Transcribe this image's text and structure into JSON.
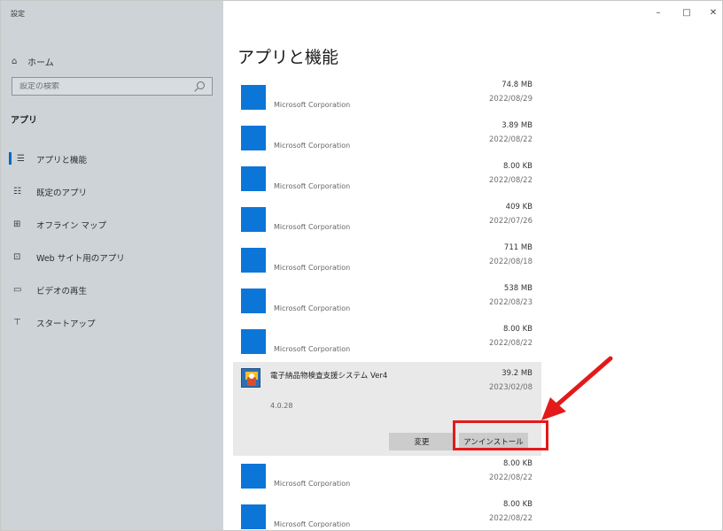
{
  "window": {
    "title": "設定",
    "controls": {
      "minimize": "–",
      "maximize": "□",
      "close": "✕"
    }
  },
  "sidebar": {
    "home": {
      "icon": "home-icon",
      "label": "ホーム"
    },
    "search": {
      "placeholder": "設定の検索",
      "icon": "search-icon"
    },
    "section_title": "アプリ",
    "items": [
      {
        "icon": "apps-features-icon",
        "label": "アプリと機能",
        "active": true
      },
      {
        "icon": "default-apps-icon",
        "label": "既定のアプリ",
        "active": false
      },
      {
        "icon": "offline-maps-icon",
        "label": "オフライン マップ",
        "active": false
      },
      {
        "icon": "web-apps-icon",
        "label": "Web サイト用のアプリ",
        "active": false
      },
      {
        "icon": "video-playback-icon",
        "label": "ビデオの再生",
        "active": false
      },
      {
        "icon": "startup-icon",
        "label": "スタートアップ",
        "active": false
      }
    ]
  },
  "main": {
    "title": "アプリと機能",
    "apps_before": [
      {
        "publisher": "Microsoft Corporation",
        "size": "74.8 MB",
        "date": "2022/08/29"
      },
      {
        "publisher": "Microsoft Corporation",
        "size": "3.89 MB",
        "date": "2022/08/22"
      },
      {
        "publisher": "Microsoft Corporation",
        "size": "8.00 KB",
        "date": "2022/08/22"
      },
      {
        "publisher": "Microsoft Corporation",
        "size": "409 KB",
        "date": "2022/07/26"
      },
      {
        "publisher": "Microsoft Corporation",
        "size": "711 MB",
        "date": "2022/08/18"
      },
      {
        "publisher": "Microsoft Corporation",
        "size": "538 MB",
        "date": "2022/08/23"
      },
      {
        "publisher": "Microsoft Corporation",
        "size": "8.00 KB",
        "date": "2022/08/22"
      }
    ],
    "selected_app": {
      "name": "電子納品物検査支援システム Ver4",
      "size": "39.2 MB",
      "date": "2023/02/08",
      "version": "4.0.28",
      "modify_label": "変更",
      "uninstall_label": "アンインストール"
    },
    "apps_after": [
      {
        "publisher": "Microsoft Corporation",
        "size": "8.00 KB",
        "date": "2022/08/22"
      },
      {
        "publisher": "Microsoft Corporation",
        "size": "8.00 KB",
        "date": "2022/08/22"
      }
    ]
  },
  "annotation": {
    "color": "#e31a1a"
  }
}
